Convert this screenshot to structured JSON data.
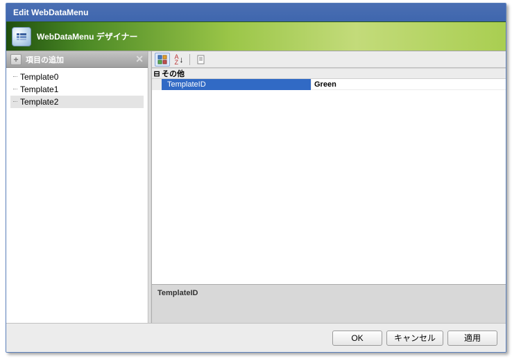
{
  "titlebar": {
    "title": "Edit WebDataMenu"
  },
  "banner": {
    "title": "WebDataMenu デザイナー",
    "icon": "webdatamenu-icon"
  },
  "sidebar": {
    "add_label": "項目の追加",
    "items": [
      {
        "label": "Template0",
        "selected": false
      },
      {
        "label": "Template1",
        "selected": false
      },
      {
        "label": "Template2",
        "selected": true
      }
    ]
  },
  "property_grid": {
    "category": "その他",
    "rows": [
      {
        "name": "TemplateID",
        "value": "Green"
      }
    ]
  },
  "description": {
    "title": "TemplateID"
  },
  "footer": {
    "ok": "OK",
    "cancel": "キャンセル",
    "apply": "適用"
  }
}
